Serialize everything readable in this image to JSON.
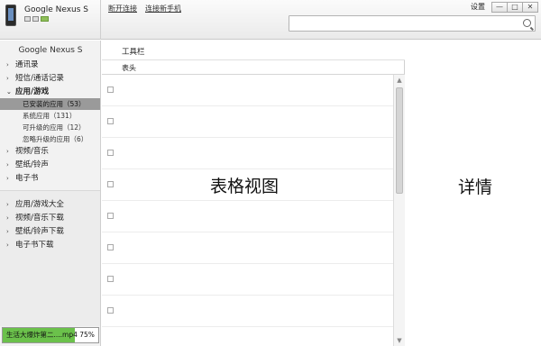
{
  "device": {
    "name": "Google Nexus S",
    "icons": [
      "sd-card-icon",
      "photo-icon",
      "battery-icon"
    ]
  },
  "top_links": [
    "断开连接",
    "连接新手机"
  ],
  "window": {
    "settings_label": "设置",
    "minimize": "—",
    "restore": "□",
    "close": "✕"
  },
  "search": {
    "placeholder": "",
    "value": ""
  },
  "sidebar": {
    "header": "Google Nexus S",
    "items": [
      {
        "label": "通讯录",
        "arrow": "›"
      },
      {
        "label": "短信/通话记录",
        "arrow": "›"
      },
      {
        "label": "应用/游戏",
        "arrow": "⌄",
        "bold": true
      },
      {
        "label": "视频/音乐",
        "arrow": "›"
      },
      {
        "label": "壁纸/铃声",
        "arrow": "›"
      },
      {
        "label": "电子书",
        "arrow": "›"
      }
    ],
    "sub_items": [
      {
        "label": "已安装的应用（53）",
        "active": true
      },
      {
        "label": "系统应用（131）"
      },
      {
        "label": "可升级的应用（12）"
      },
      {
        "label": "忽略升级的应用（6）"
      }
    ],
    "lower_items": [
      {
        "label": "应用/游戏大全",
        "arrow": "›"
      },
      {
        "label": "视频/音乐下载",
        "arrow": "›"
      },
      {
        "label": "壁纸/铃声下载",
        "arrow": "›"
      },
      {
        "label": "电子书下载",
        "arrow": "›"
      }
    ]
  },
  "download": {
    "text": "生活大爆炸第二....mp4 75%",
    "progress": 0.75,
    "color": "#6bc14b"
  },
  "main": {
    "toolbar_label": "工具栏",
    "table_header": "表头",
    "table_view_label": "表格视图",
    "detail_label": "详情"
  }
}
